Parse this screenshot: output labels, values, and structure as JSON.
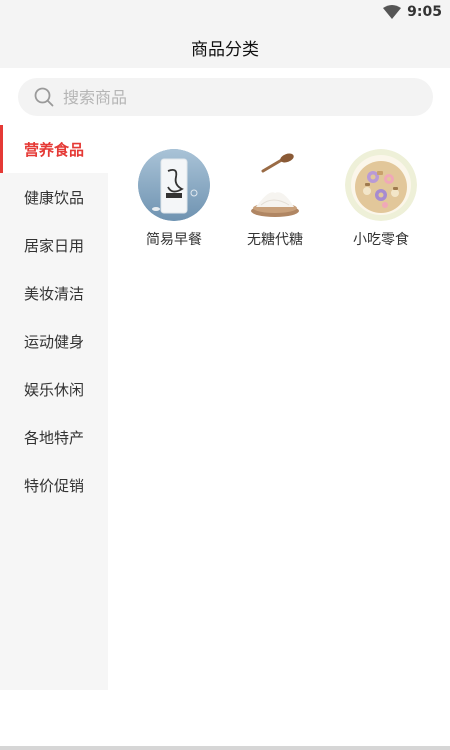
{
  "status": {
    "time": "9:05"
  },
  "header": {
    "title": "商品分类"
  },
  "search": {
    "placeholder": "搜索商品"
  },
  "sidebar": {
    "items": [
      {
        "label": "营养食品",
        "active": true
      },
      {
        "label": "健康饮品"
      },
      {
        "label": "居家日用"
      },
      {
        "label": "美妆清洁"
      },
      {
        "label": "运动健身"
      },
      {
        "label": "娱乐休闲"
      },
      {
        "label": "各地特产"
      },
      {
        "label": "特价促销"
      }
    ]
  },
  "subcategories": [
    {
      "label": "简易早餐",
      "icon": "milk-bottle-image"
    },
    {
      "label": "无糖代糖",
      "icon": "sugar-spoon-image"
    },
    {
      "label": "小吃零食",
      "icon": "cereal-bowl-image"
    }
  ],
  "colors": {
    "accent": "#e53935",
    "sidebar_bg": "#f6f6f6",
    "header_bg": "#f4f4f4"
  }
}
